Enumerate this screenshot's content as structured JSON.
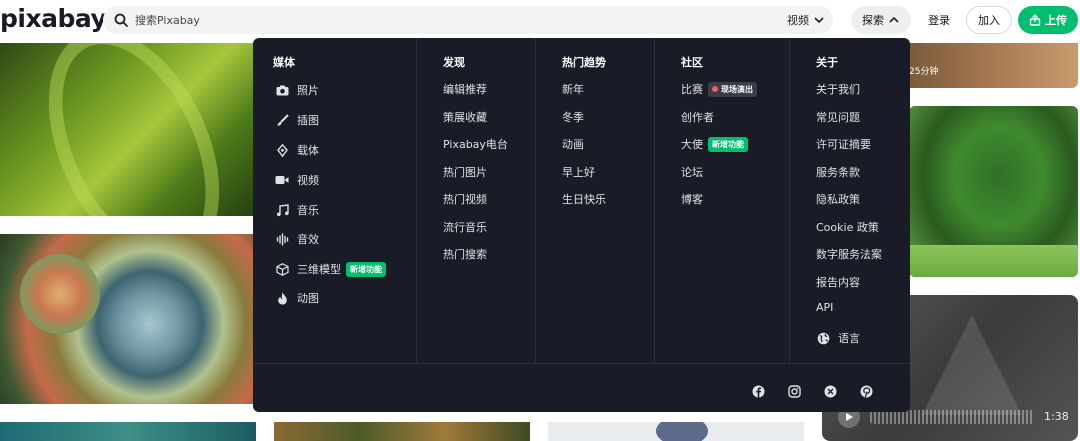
{
  "header": {
    "logo": "pixabay",
    "search_placeholder": "搜索Pixabay",
    "media_type": "视频",
    "explore_label": "探索",
    "login_label": "登录",
    "join_label": "加入",
    "upload_label": "上传",
    "accent_color": "#02be6e"
  },
  "background": {
    "top_right_duration": "25分钟",
    "video_time": "1:38"
  },
  "menu": {
    "media": {
      "heading": "媒体",
      "items": [
        {
          "label": "照片",
          "icon": "camera-icon"
        },
        {
          "label": "插图",
          "icon": "brush-icon"
        },
        {
          "label": "载体",
          "icon": "pen-nib-icon"
        },
        {
          "label": "视频",
          "icon": "video-camera-icon"
        },
        {
          "label": "音乐",
          "icon": "music-note-icon"
        },
        {
          "label": "音效",
          "icon": "sound-wave-icon"
        },
        {
          "label": "三维模型",
          "icon": "cube-icon",
          "badge": "新增功能"
        },
        {
          "label": "动图",
          "icon": "flame-icon"
        }
      ]
    },
    "discover": {
      "heading": "发现",
      "items": [
        "编辑推荐",
        "策展收藏",
        "Pixabay电台",
        "热门图片",
        "热门视频",
        "流行音乐",
        "热门搜索"
      ]
    },
    "trending": {
      "heading": "热门趋势",
      "items": [
        "新年",
        "冬季",
        "动画",
        "早上好",
        "生日快乐"
      ]
    },
    "community": {
      "heading": "社区",
      "items": [
        {
          "label": "比赛",
          "badge": "现场演出",
          "badge_type": "live"
        },
        {
          "label": "创作者"
        },
        {
          "label": "大使",
          "badge": "新增功能",
          "badge_type": "new"
        },
        {
          "label": "论坛"
        },
        {
          "label": "博客"
        }
      ]
    },
    "about": {
      "heading": "关于",
      "items": [
        "关于我们",
        "常见问题",
        "许可证摘要",
        "服务条款",
        "隐私政策",
        "Cookie 政策",
        "数字服务法案",
        "报告内容",
        "API"
      ],
      "language": "语言"
    },
    "social": [
      "facebook-icon",
      "instagram-icon",
      "x-icon",
      "pinterest-icon"
    ]
  }
}
